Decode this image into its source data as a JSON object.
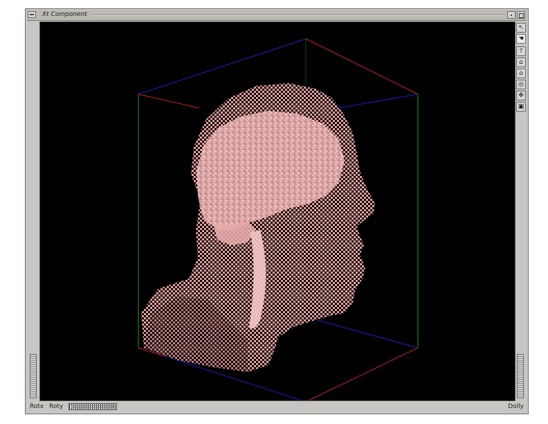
{
  "window": {
    "title": "Xt Component"
  },
  "status": {
    "rotx_label": "Rotx",
    "roty_label": "Roty",
    "dolly_label": "Dolly"
  },
  "toolbar": {
    "buttons": [
      {
        "name": "pick-arrow-icon",
        "glyph": "↖"
      },
      {
        "name": "view-hand-icon",
        "glyph": "☚"
      },
      {
        "name": "help-icon",
        "glyph": "?"
      },
      {
        "name": "home-icon",
        "glyph": "⌂"
      },
      {
        "name": "set-home-icon",
        "glyph": "⌂"
      },
      {
        "name": "view-all-icon",
        "glyph": "◎"
      },
      {
        "name": "seek-icon",
        "glyph": "✥"
      },
      {
        "name": "projection-icon",
        "glyph": "▣"
      }
    ]
  },
  "scene": {
    "background": "#000000",
    "model": "translucent head volume with brain",
    "box_colors": {
      "x_axis": "#d22020",
      "y_axis": "#1aa01a",
      "z_axis": "#2020c8"
    },
    "skin_color": "#e8a0a0",
    "brain_color": "#f4c8c8"
  }
}
